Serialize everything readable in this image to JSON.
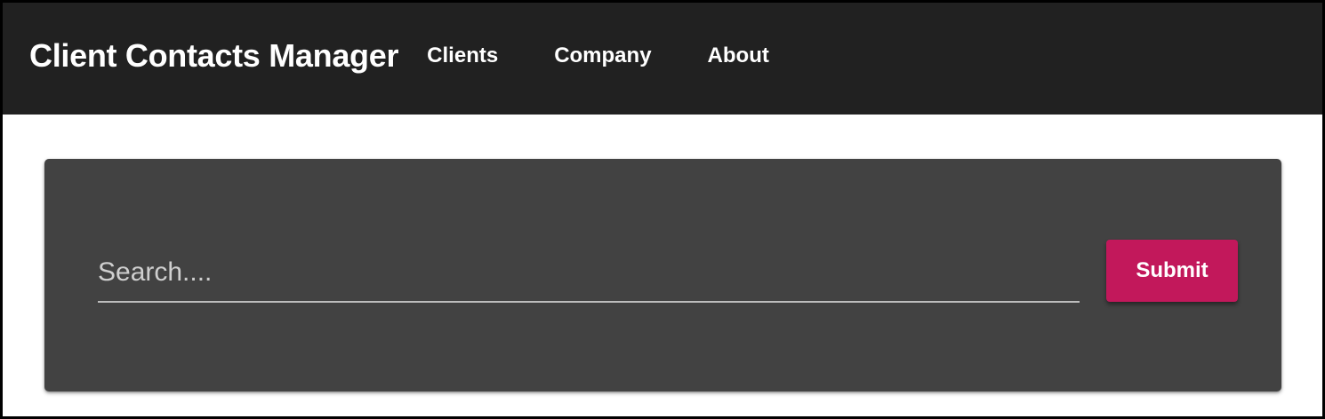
{
  "app": {
    "title": "Client Contacts Manager"
  },
  "nav": {
    "items": [
      {
        "label": "Clients"
      },
      {
        "label": "Company"
      },
      {
        "label": "About"
      }
    ]
  },
  "search": {
    "placeholder": "Search....",
    "value": "",
    "submit_label": "Submit"
  },
  "colors": {
    "toolbar_background": "#212121",
    "card_background": "#424242",
    "accent": "#c2185b"
  }
}
